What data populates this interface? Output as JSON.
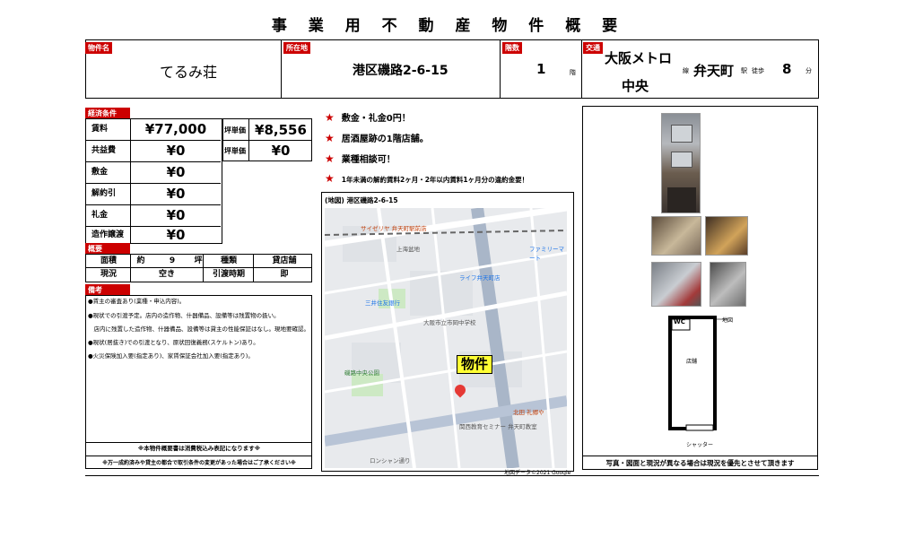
{
  "title": "事 業 用 不 動 産 物 件 概 要",
  "header": {
    "name_label": "物件名",
    "name_value": "てるみ荘",
    "address_label": "所在地",
    "address_value": "港区磯路2-6-15",
    "floors_label": "階数",
    "floors_value": "1",
    "floors_unit": "階",
    "transport_label": "交通",
    "line_name_1": "大阪メトロ",
    "line_name_2": "中央",
    "line_unit": "線",
    "station_name": "弁天町",
    "station_unit": "駅",
    "walk_label": "徒歩",
    "walk_minutes": "8",
    "walk_unit": "分"
  },
  "finance": {
    "section_label": "経済条件",
    "rows": [
      {
        "label": "賃料",
        "value": "¥77,000"
      },
      {
        "label": "共益費",
        "value": "¥0"
      },
      {
        "label": "敷金",
        "value": "¥0"
      },
      {
        "label": "解約引",
        "value": "¥0"
      },
      {
        "label": "礼金",
        "value": "¥0"
      },
      {
        "label": "造作譲渡",
        "value": "¥0"
      }
    ],
    "tsubo_rows": [
      {
        "label": "坪単価",
        "value": "¥8,556"
      },
      {
        "label": "坪単価",
        "value": "¥0"
      }
    ]
  },
  "overview": {
    "section_label": "概要",
    "area_label": "面積",
    "area_prefix": "約",
    "area_value": "9",
    "area_unit": "坪",
    "type_label": "種類",
    "type_value": "貸店舗",
    "status_label": "現況",
    "status_value": "空き",
    "handover_label": "引渡時期",
    "handover_value": "即"
  },
  "remarks": {
    "section_label": "備考",
    "lines": [
      "●賃主の審査あり(業種・申込内容)。",
      "●現状での引渡予定。店内の造作物、什器備品、設備等は残置物の扱い。",
      "　店内に残置した造作物、什器備品、設備等は貸主の性能保証はなし。現地要確認。",
      "●現状(居抜き)での引渡となり、原状回復義務(スケルトン)あり。",
      "●火災保険加入要(指定あり)、家賃保証会社加入要(指定あり)。"
    ],
    "tax_note": "※本物件概要書は消費税込み表記になります※",
    "change_note": "※万一成約済みや貸主の都合で取引条件の変更があった場合はご了承ください※"
  },
  "features": [
    "敷金・礼金0円！",
    "居酒屋跡の1階店舗。",
    "業種相談可！",
    "1年未満の解約賃料2ヶ月・2年以内賃料1ヶ月分の違約金要！"
  ],
  "map": {
    "caption": "(地図) 港区磯路2-6-15",
    "pin_label": "物件",
    "copyright": "地図データ©2021 Google",
    "places": [
      "サイゼリヤ 弁天町駅前店",
      "上海盆地",
      "大阪市立市岡中学校",
      "ライフ弁天町店",
      "三井住友銀行",
      "磯路中央公園",
      "関西教育セミナー 弁天町教室",
      "ロンシャン通り",
      "ファミリーマート",
      "北田 礼郷や"
    ]
  },
  "floorplan": {
    "wc_label": "WC",
    "north_label": "地図",
    "shop_label": "店舗",
    "shutter_label": "シャッター"
  },
  "photo_note": "写真・図面と現況が異なる場合は現況を優先とさせて頂きます",
  "colors": {
    "label_red": "#cc0000",
    "map_bg": "#e8eaed",
    "pin_yellow": "#ffff33"
  }
}
